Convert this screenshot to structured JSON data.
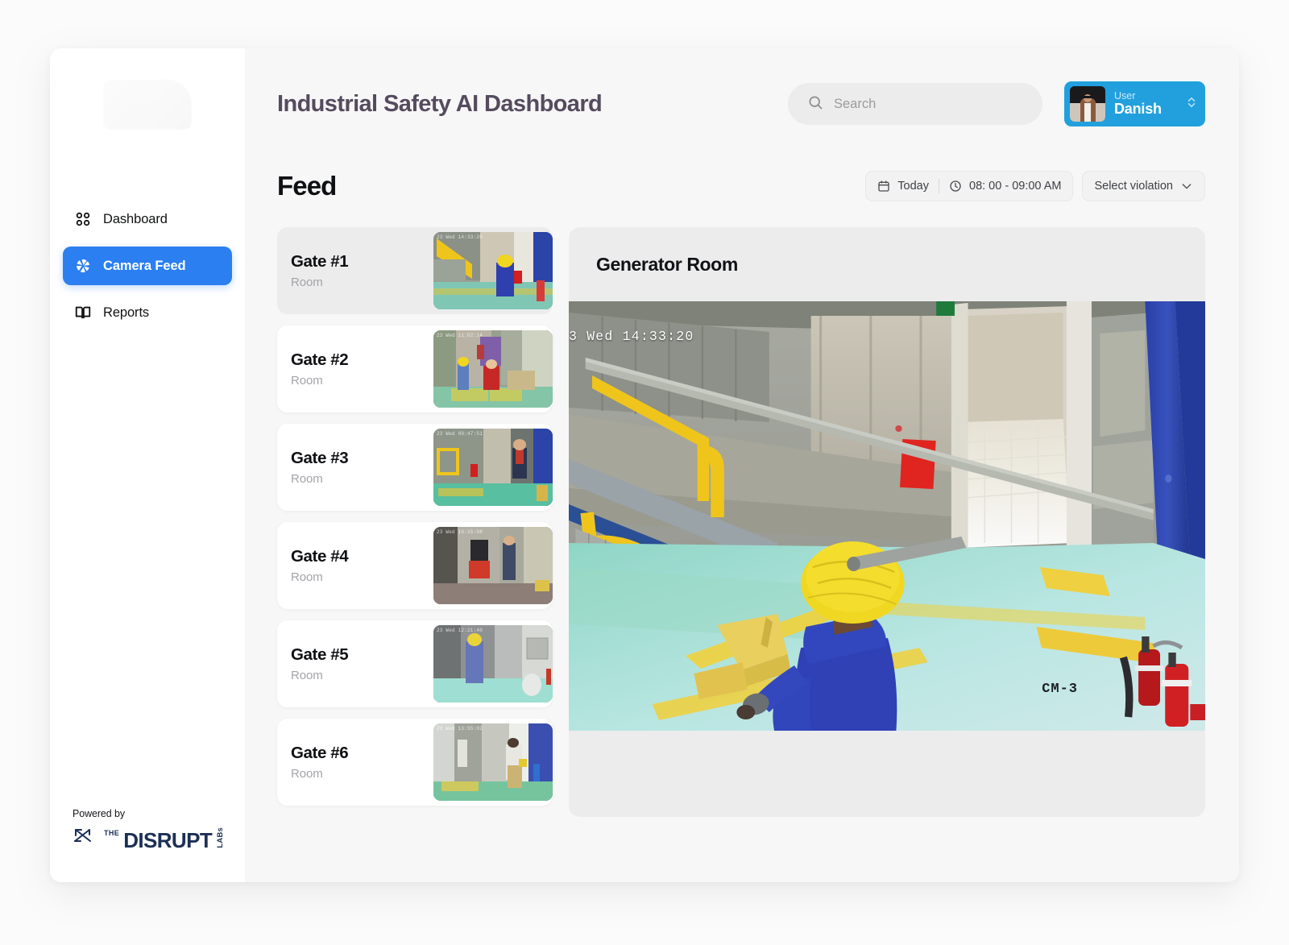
{
  "brand": {
    "powered_by": "Powered by",
    "logo_the": "THE",
    "logo_word": "DISRUPT",
    "logo_labs": "LABs"
  },
  "sidebar": {
    "items": [
      {
        "label": "Dashboard",
        "icon": "grid-icon",
        "active": false
      },
      {
        "label": "Camera Feed",
        "icon": "aperture-icon",
        "active": true
      },
      {
        "label": "Reports",
        "icon": "book-icon",
        "active": false
      }
    ]
  },
  "header": {
    "title": "Industrial Safety AI Dashboard",
    "search": {
      "value": "",
      "placeholder": "Search",
      "icon": "search-icon"
    },
    "user": {
      "role_label": "User",
      "name": "Danish",
      "avatar": "user-avatar",
      "chevron": "chevron-up-down-icon"
    }
  },
  "feed": {
    "title": "Feed",
    "filters": {
      "date_label": "Today",
      "date_icon": "calendar-icon",
      "time_label": "08: 00 - 09:00 AM",
      "time_icon": "clock-icon",
      "violation_label": "Select violation",
      "violation_icon": "chevron-down-icon"
    },
    "gates": [
      {
        "name": "Gate #1",
        "room": "Room",
        "selected": true,
        "thumb_ts": "23 Wed 14:33:20"
      },
      {
        "name": "Gate #2",
        "room": "Room",
        "selected": false,
        "thumb_ts": "23 Wed 11:02:14"
      },
      {
        "name": "Gate #3",
        "room": "Room",
        "selected": false,
        "thumb_ts": "23 Wed 09:47:51"
      },
      {
        "name": "Gate #4",
        "room": "Room",
        "selected": false,
        "thumb_ts": "23 Wed 10:15:08"
      },
      {
        "name": "Gate #5",
        "room": "Room",
        "selected": false,
        "thumb_ts": "23 Wed 12:21:40"
      },
      {
        "name": "Gate #6",
        "room": "Room",
        "selected": false,
        "thumb_ts": "23 Wed 13:55:02"
      }
    ]
  },
  "viewer": {
    "title": "Generator Room",
    "timestamp_overlay": "3 Wed 14:33:20",
    "camera_tag": "CM-3"
  },
  "colors": {
    "accent_blue": "#2b7ff0",
    "user_chip_blue": "#21a0dd",
    "title_purple": "#554b5e",
    "page_bg": "#f7f7f7",
    "card_white": "#ffffff",
    "selected_gray": "#ececec"
  }
}
